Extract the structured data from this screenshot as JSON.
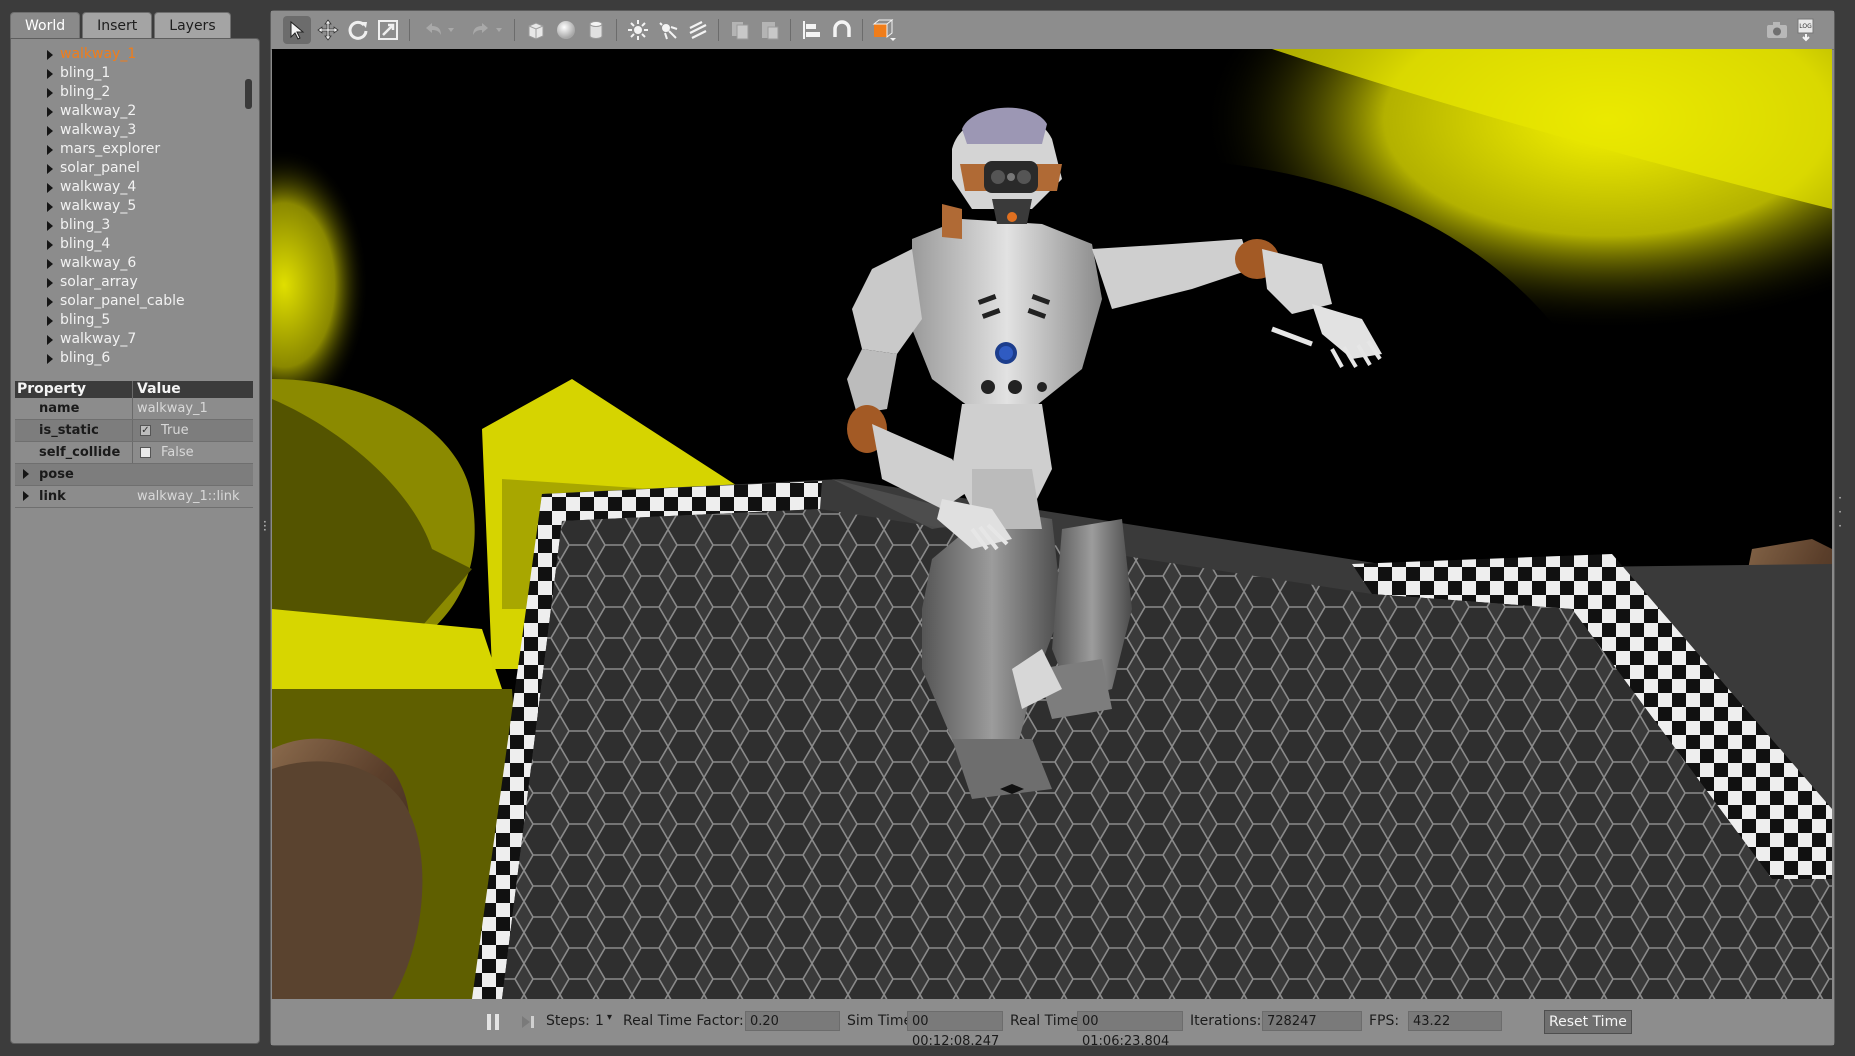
{
  "tabs": [
    {
      "label": "World",
      "active": true
    },
    {
      "label": "Insert",
      "active": false
    },
    {
      "label": "Layers",
      "active": false
    }
  ],
  "tree": {
    "items": [
      {
        "label": "walkway_1",
        "selected": true
      },
      {
        "label": "bling_1"
      },
      {
        "label": "bling_2"
      },
      {
        "label": "walkway_2"
      },
      {
        "label": "walkway_3"
      },
      {
        "label": "mars_explorer"
      },
      {
        "label": "solar_panel"
      },
      {
        "label": "walkway_4"
      },
      {
        "label": "walkway_5"
      },
      {
        "label": "bling_3"
      },
      {
        "label": "bling_4"
      },
      {
        "label": "walkway_6"
      },
      {
        "label": "solar_array"
      },
      {
        "label": "solar_panel_cable"
      },
      {
        "label": "bling_5"
      },
      {
        "label": "walkway_7"
      },
      {
        "label": "bling_6"
      }
    ],
    "selected_color": "#f07d1a"
  },
  "properties": {
    "header": {
      "property": "Property",
      "value": "Value"
    },
    "rows": [
      {
        "name": "name",
        "value": "walkway_1",
        "type": "text"
      },
      {
        "name": "is_static",
        "value": "True",
        "type": "checkbox",
        "checked": true
      },
      {
        "name": "self_collide",
        "value": "False",
        "type": "checkbox",
        "checked": false
      },
      {
        "name": "pose",
        "value": "",
        "type": "expandable"
      },
      {
        "name": "link",
        "value": "walkway_1::link",
        "type": "expandable"
      }
    ]
  },
  "toolbar": {
    "tools": [
      "select-arrow-icon",
      "translate-icon",
      "rotate-icon",
      "scale-icon",
      "undo-icon",
      "redo-icon",
      "box-icon",
      "sphere-icon",
      "cylinder-icon",
      "point-light-icon",
      "spot-light-icon",
      "directional-light-icon",
      "copy-icon",
      "paste-icon",
      "align-icon",
      "snap-magnet-icon",
      "view-angle-icon",
      "screenshot-icon",
      "log-icon"
    ],
    "log_label": "LOG"
  },
  "viewport": {
    "scene": "robot on hexagonal walkway platform",
    "colors": {
      "sky": "#000000",
      "glow": "#e8e600",
      "platform": "#3a3a3a"
    }
  },
  "status": {
    "steps_label": "Steps:",
    "steps_value": "1",
    "rtf_label": "Real Time Factor:",
    "rtf_value": "0.20",
    "sim_time_label": "Sim Time:",
    "sim_time_value": "00 00:12:08.247",
    "real_time_label": "Real Time:",
    "real_time_value": "00 01:06:23.804",
    "iterations_label": "Iterations:",
    "iterations_value": "728247",
    "fps_label": "FPS:",
    "fps_value": "43.22",
    "reset_label": "Reset Time"
  }
}
